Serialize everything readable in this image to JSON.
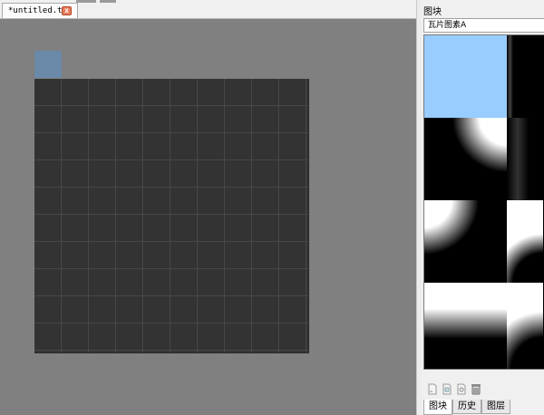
{
  "document": {
    "tab_title": "*untitled.tmx",
    "close_glyph": "x"
  },
  "tileset_panel": {
    "title": "图块",
    "selected_tileset": "瓦片图素A",
    "tool_icons": [
      "new-tileset-icon",
      "import-tileset-icon",
      "edit-tileset-icon",
      "remove-tileset-icon"
    ],
    "tabs": [
      {
        "label": "图块",
        "active": true
      },
      {
        "label": "历史",
        "active": false
      },
      {
        "label": "图层",
        "active": false
      }
    ]
  },
  "colors": {
    "canvas_background": "#808080",
    "map_fill": "#333333",
    "selection_tile": "#6b89a8",
    "tileset_selected": "#99ccff"
  }
}
